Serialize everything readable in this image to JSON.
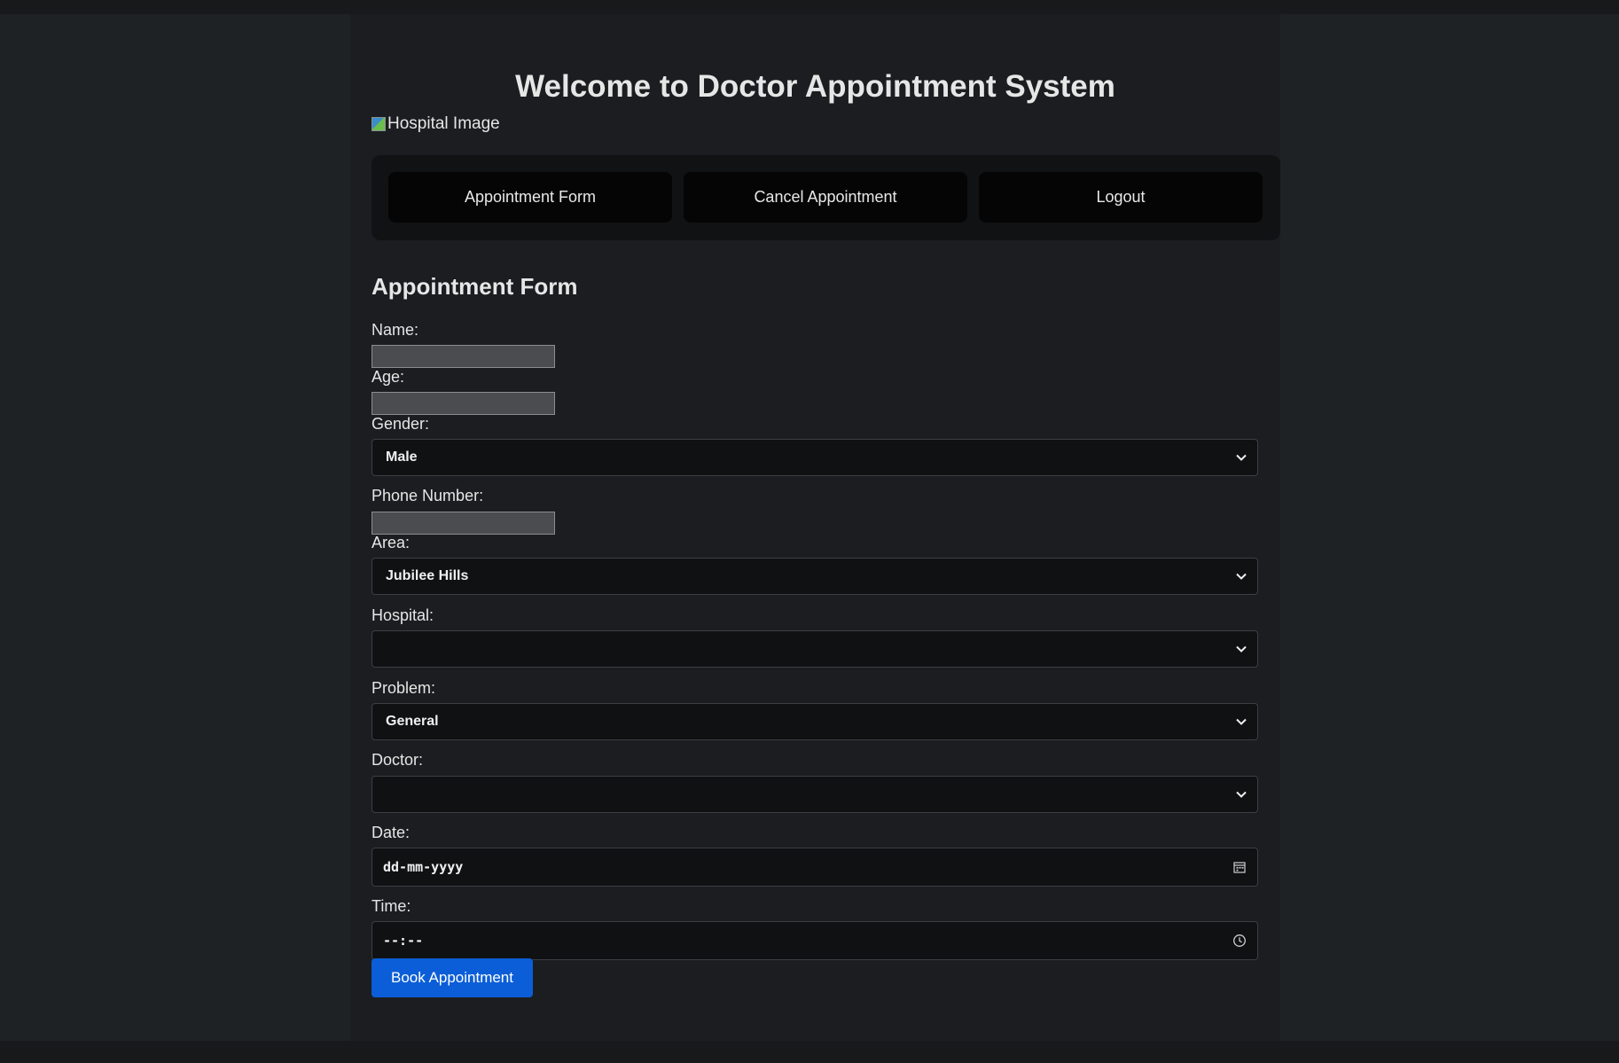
{
  "header": {
    "title": "Welcome to Doctor Appointment System",
    "image_alt": "Hospital Image"
  },
  "nav": {
    "items": [
      {
        "label": "Appointment Form"
      },
      {
        "label": "Cancel Appointment"
      },
      {
        "label": "Logout"
      }
    ]
  },
  "form": {
    "title": "Appointment Form",
    "name_label": "Name:",
    "name_value": "",
    "age_label": "Age:",
    "age_value": "",
    "gender_label": "Gender:",
    "gender_value": "Male",
    "phone_label": "Phone Number:",
    "phone_value": "",
    "area_label": "Area:",
    "area_value": "Jubilee Hills",
    "hospital_label": "Hospital:",
    "hospital_value": "",
    "problem_label": "Problem:",
    "problem_value": "General",
    "doctor_label": "Doctor:",
    "doctor_value": "",
    "date_label": "Date:",
    "date_placeholder": "dd-mm-yyyy",
    "time_label": "Time:",
    "time_placeholder": "--:--",
    "submit_label": "Book Appointment"
  },
  "colors": {
    "background": "#1f2225",
    "container": "#1b1d20",
    "nav_bar": "#111214",
    "nav_button": "#050505",
    "field_bg": "#101113",
    "text_input_bg": "#4a4c50",
    "accent": "#0b5ed7"
  },
  "icons": {
    "dropdown": "chevron-down-icon",
    "date": "calendar-icon",
    "time": "clock-icon",
    "image": "broken-image-icon"
  }
}
